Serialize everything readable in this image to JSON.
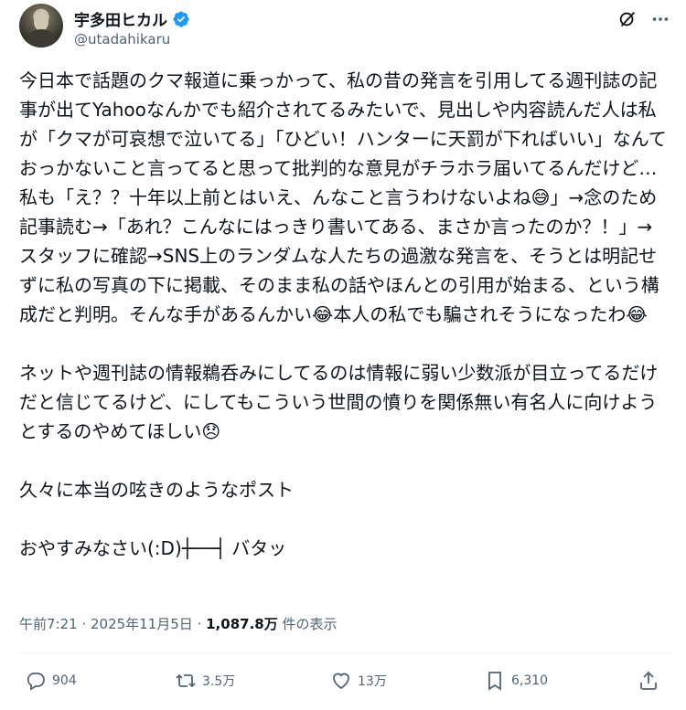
{
  "author": {
    "display_name": "宇多田ヒカル",
    "handle": "@utadahikaru",
    "verified": true
  },
  "icons": {
    "grok": "grok-icon",
    "more": "more-icon",
    "reply": "reply-icon",
    "repost": "repost-icon",
    "like": "like-icon",
    "bookmark": "bookmark-icon",
    "share": "share-icon"
  },
  "tweet": {
    "paragraph1": "今日本で話題のクマ報道に乗っかって、私の昔の発言を引用してる週刊誌の記事が出てYahooなんかでも紹介されてるみたいで、見出しや内容読んだ人は私が「クマが可哀想で泣いてる」「ひどい！ハンターに天罰が下ればいい」なんておっかないこと言ってると思って批判的な意見がチラホラ届いてるんだけど…私も「え？？十年以上前とはいえ、んなこと言うわけないよね😅」→念のため記事読む→「あれ？こんなにはっきり書いてある、まさか言ったのか？！」→スタッフに確認→SNS上のランダムな人たちの過激な発言を、そうとは明記せずに私の写真の下に掲載、そのまま私の話やほんとの引用が始まる、という構成だと判明。そんな手があるんかい😂本人の私でも騙されそうになったわ😂",
    "paragraph2": "ネットや週刊誌の情報鵜呑みにしてるのは情報に弱い少数派が目立ってるだけだと信じてるけど、にしてもこういう世間の憤りを関係無い有名人に向けようとするのやめてほしい😞",
    "paragraph3": "久々に本当の呟きのようなポスト",
    "paragraph4": "おやすみなさい(:D)┼──┤ バタッ"
  },
  "meta": {
    "time": "午前7:21",
    "sep1": " · ",
    "date": "2025年11月5日",
    "sep2": " · ",
    "views": "1,087.8万",
    "views_label": " 件の表示"
  },
  "actions": {
    "replies": "904",
    "reposts": "3.5万",
    "likes": "13万",
    "bookmarks": "6,310"
  },
  "colors": {
    "text": "#0f1419",
    "secondary": "#536471",
    "verified_blue": "#1d9bf0",
    "divider": "#eff3f4"
  }
}
